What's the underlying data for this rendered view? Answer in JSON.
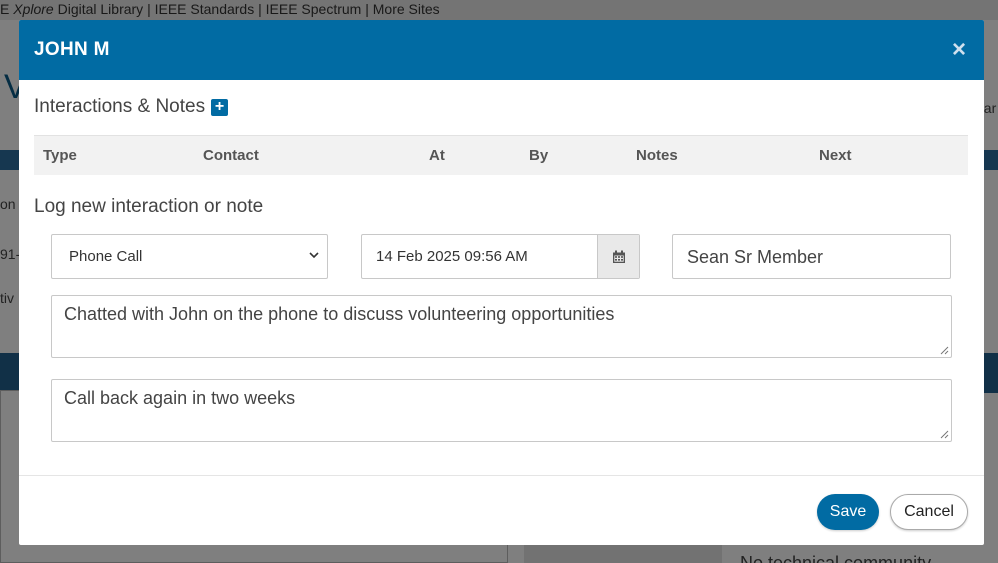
{
  "background": {
    "topbar": {
      "prefix": "E",
      "brand_italic": "Xplore",
      "text": "Digital Library | IEEE Standards | IEEE Spectrum | More Sites"
    },
    "logo_fragment": "V",
    "frag_on": "on",
    "frag_91": "91-",
    "frag_tiv": "tiv",
    "frag_ear": "ear",
    "bottom_fragment": "No technical community"
  },
  "modal": {
    "title": "JOHN M",
    "close_glyph": "×",
    "section_title": "Interactions & Notes",
    "add_glyph": "+",
    "table": {
      "columns": [
        "Type",
        "Contact",
        "At",
        "By",
        "Notes",
        "Next"
      ]
    },
    "log_title": "Log new interaction or note",
    "form": {
      "type_selected": "Phone Call",
      "datetime": "14 Feb 2025 09:56 AM",
      "by": "Sean Sr Member",
      "notes": "Chatted with John on the phone to discuss volunteering opportunities",
      "next": "Call back again in two weeks"
    },
    "footer": {
      "save_label": "Save",
      "cancel_label": "Cancel"
    }
  },
  "colors": {
    "accent": "#016ba3",
    "overlay": "rgba(0,0,0,0.5)"
  },
  "icons": {
    "close": "close-icon",
    "add": "plus-square-icon",
    "calendar": "calendar-icon",
    "dropdown": "chevron-down-icon"
  }
}
